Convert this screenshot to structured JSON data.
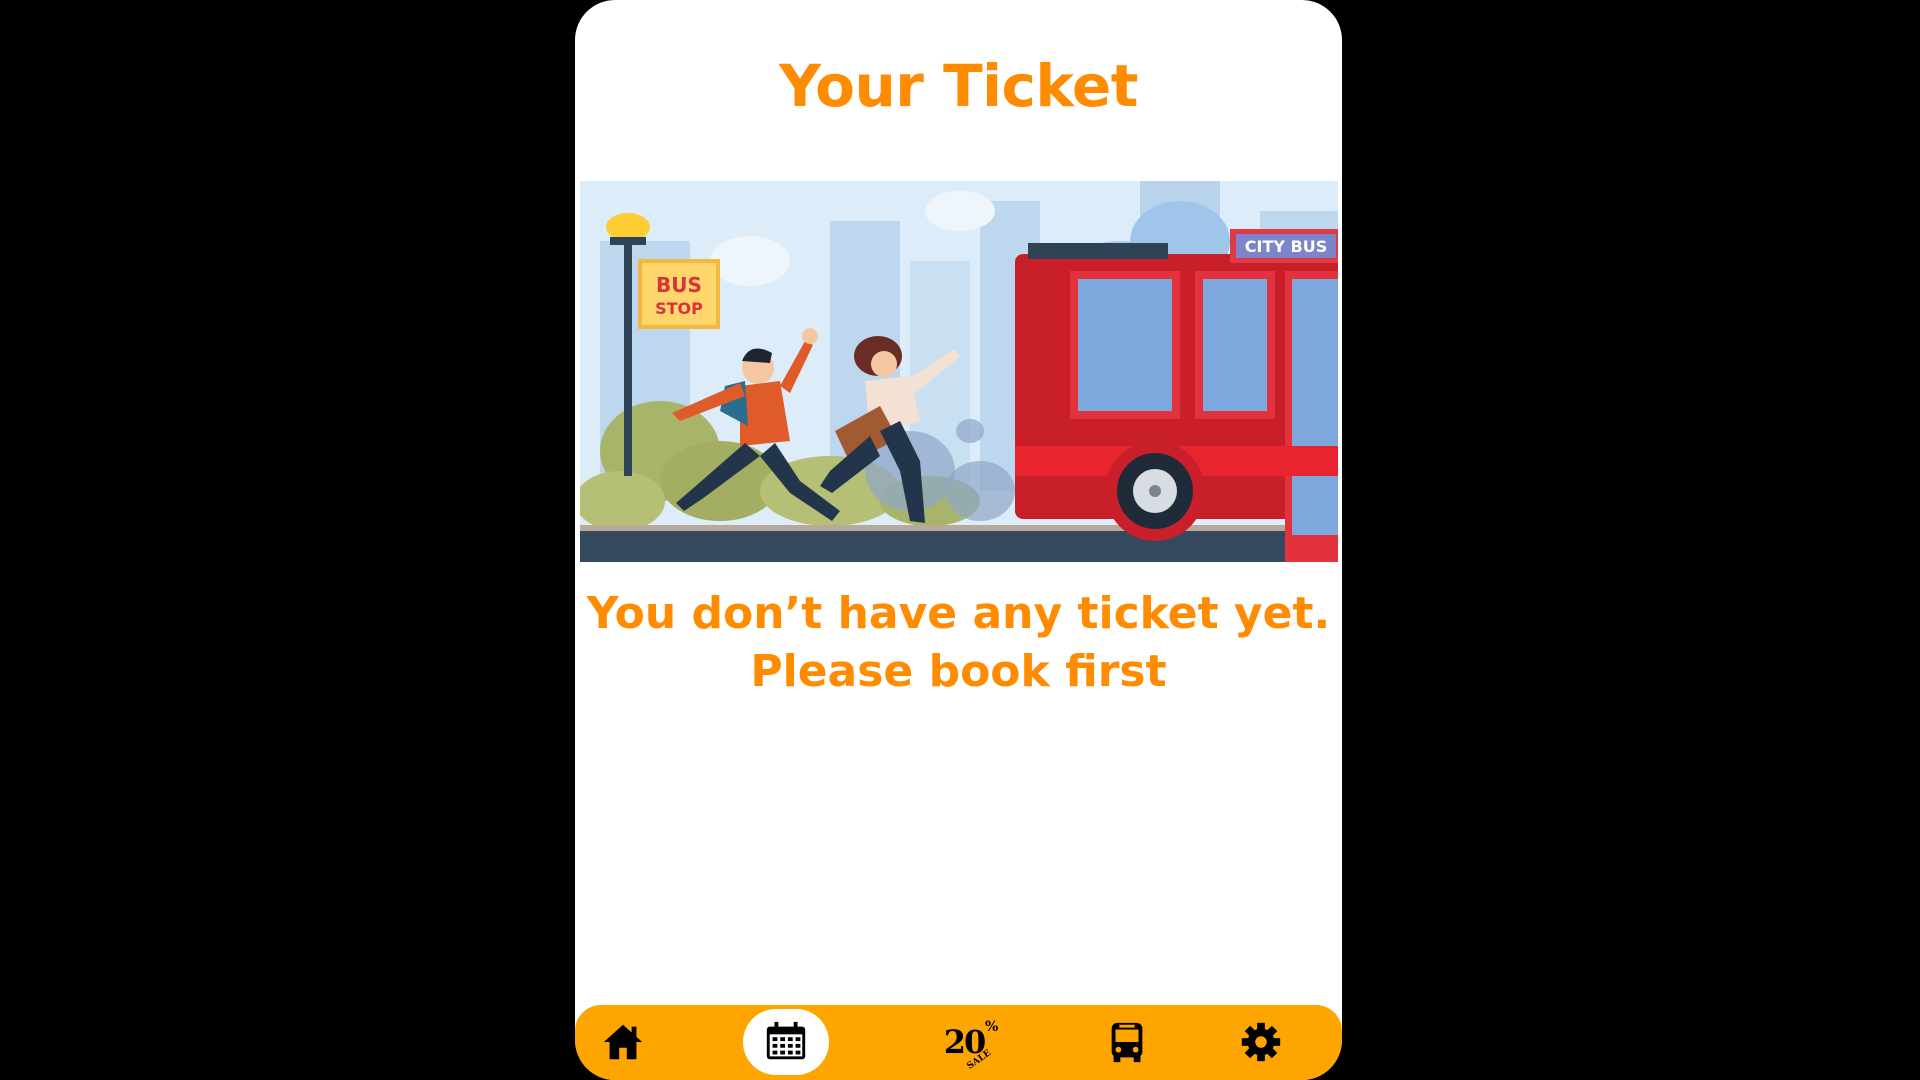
{
  "page": {
    "title": "Your Ticket",
    "message_line1": "You don’t have any ticket yet.",
    "message_line2": "Please book first"
  },
  "illustration": {
    "bus_stop_sign_line1": "BUS",
    "bus_stop_sign_line2": "STOP",
    "bus_sign": "CITY BUS"
  },
  "navbar": {
    "items": [
      {
        "name": "home",
        "icon": "home-icon",
        "active": false
      },
      {
        "name": "calendar",
        "icon": "calendar-icon",
        "active": true
      },
      {
        "name": "sale",
        "icon": "sale-20-percent-icon",
        "active": false,
        "label": "20",
        "percent": "%",
        "word": "SALE"
      },
      {
        "name": "bus",
        "icon": "bus-icon",
        "active": false
      },
      {
        "name": "settings",
        "icon": "gear-icon",
        "active": false
      }
    ]
  },
  "colors": {
    "accent": "#ff8c00",
    "navbar": "#ffa500",
    "background": "#000000",
    "card": "#ffffff"
  }
}
